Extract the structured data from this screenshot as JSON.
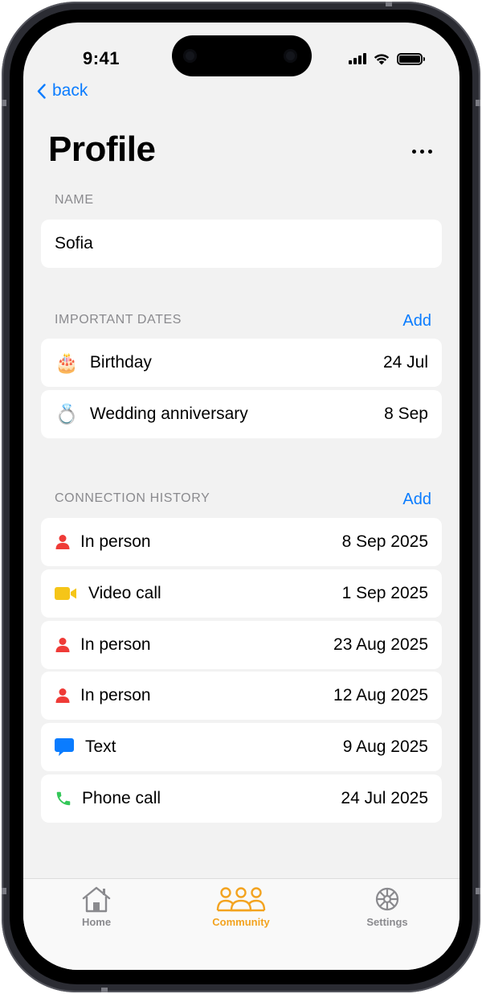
{
  "status_bar": {
    "time": "9:41"
  },
  "nav": {
    "back_label": "back"
  },
  "header": {
    "title": "Profile"
  },
  "name_section": {
    "label": "NAME",
    "value": "Sofia"
  },
  "dates_section": {
    "label": "IMPORTANT DATES",
    "add_label": "Add",
    "items": [
      {
        "icon": "🎂",
        "icon_name": "birthday-cake-icon",
        "label": "Birthday",
        "value": "24 Jul"
      },
      {
        "icon": "💍",
        "icon_name": "ring-icon",
        "label": "Wedding anniversary",
        "value": "8 Sep"
      }
    ]
  },
  "history_section": {
    "label": "CONNECTION HISTORY",
    "add_label": "Add",
    "items": [
      {
        "type": "person",
        "label": "In person",
        "value": "8 Sep 2025"
      },
      {
        "type": "video",
        "label": "Video call",
        "value": "1 Sep 2025"
      },
      {
        "type": "person",
        "label": "In person",
        "value": "23 Aug 2025"
      },
      {
        "type": "person",
        "label": "In person",
        "value": "12 Aug 2025"
      },
      {
        "type": "text",
        "label": "Text",
        "value": "9 Aug 2025"
      },
      {
        "type": "phone",
        "label": "Phone call",
        "value": "24 Jul 2025"
      }
    ]
  },
  "tab_bar": {
    "tabs": [
      {
        "label": "Home",
        "active": false
      },
      {
        "label": "Community",
        "active": true
      },
      {
        "label": "Settings",
        "active": false
      }
    ]
  },
  "colors": {
    "accent_blue": "#0a7cff",
    "active_tab": "#f3a31f",
    "inactive_tab": "#8a8a8e",
    "person_red": "#ef3b37",
    "video_yellow": "#f5c518",
    "text_blue": "#0a7cff",
    "phone_green": "#34c759"
  }
}
